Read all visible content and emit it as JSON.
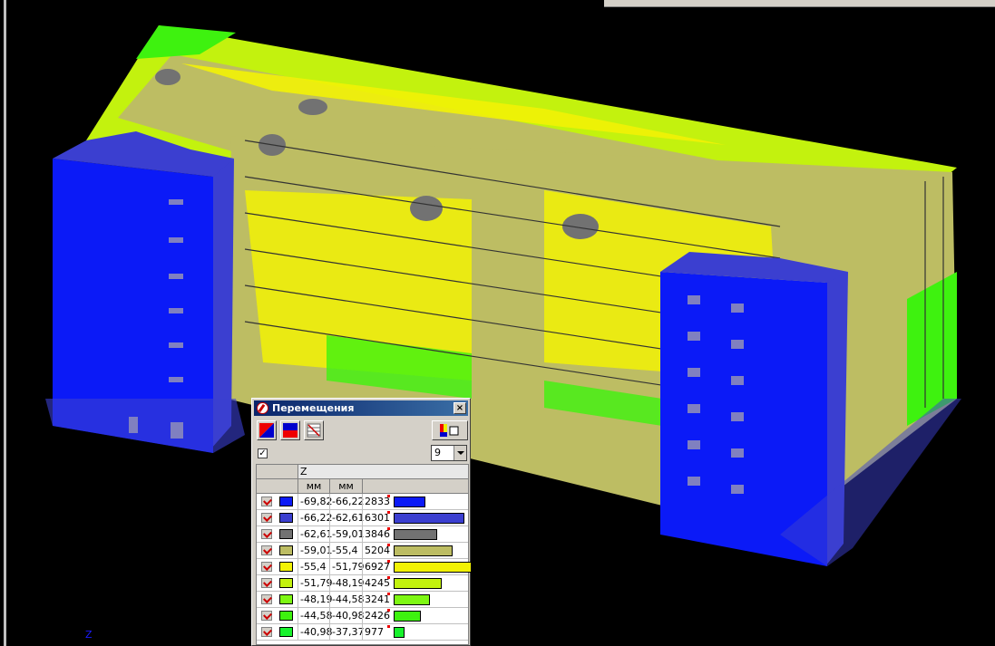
{
  "colors": {
    "deep_blue": "#0b1af7",
    "blue": "#3b3fd0",
    "gray": "#727272",
    "olive": "#bdbd63",
    "yellow": "#f2f205",
    "yellowgreen": "#c3f20e",
    "lightgreen": "#7ef713",
    "green": "#3ef20f",
    "bright_green": "#17f22c",
    "background": "#000000"
  },
  "viewport": {
    "axis_label": "Z"
  },
  "panel": {
    "title": "Перемещения",
    "close_label": "×",
    "toolbar": {
      "icon1": "color-scale-icon",
      "icon2": "color-fill-icon",
      "icon3": "table-icon",
      "icon4": "layout-icon"
    },
    "checkbox_checked": true,
    "checkbox_mark": "✓",
    "combo_value": "9",
    "component_label": "Z",
    "units": [
      "мм",
      "мм"
    ],
    "rows": [
      {
        "from": "-69,82",
        "to": "-66,22",
        "count": "2833",
        "count_num": 2833,
        "color": "#0b1af7"
      },
      {
        "from": "-66,22",
        "to": "-62,61",
        "count": "6301",
        "count_num": 6301,
        "color": "#3b3fd0"
      },
      {
        "from": "-62,61",
        "to": "-59,01",
        "count": "3846",
        "count_num": 3846,
        "color": "#727272"
      },
      {
        "from": "-59,01",
        "to": "-55,4",
        "count": "5204",
        "count_num": 5204,
        "color": "#bdbd63"
      },
      {
        "from": "-55,4",
        "to": "-51,79",
        "count": "6927",
        "count_num": 6927,
        "color": "#f2f205"
      },
      {
        "from": "-51,79",
        "to": "-48,19",
        "count": "4245",
        "count_num": 4245,
        "color": "#c3f20e"
      },
      {
        "from": "-48,19",
        "to": "-44,58",
        "count": "3241",
        "count_num": 3241,
        "color": "#7ef713"
      },
      {
        "from": "-44,58",
        "to": "-40,98",
        "count": "2426",
        "count_num": 2426,
        "color": "#3ef20f"
      },
      {
        "from": "-40,98",
        "to": "-37,37",
        "count": "977",
        "count_num": 977,
        "color": "#17f22c"
      }
    ]
  }
}
